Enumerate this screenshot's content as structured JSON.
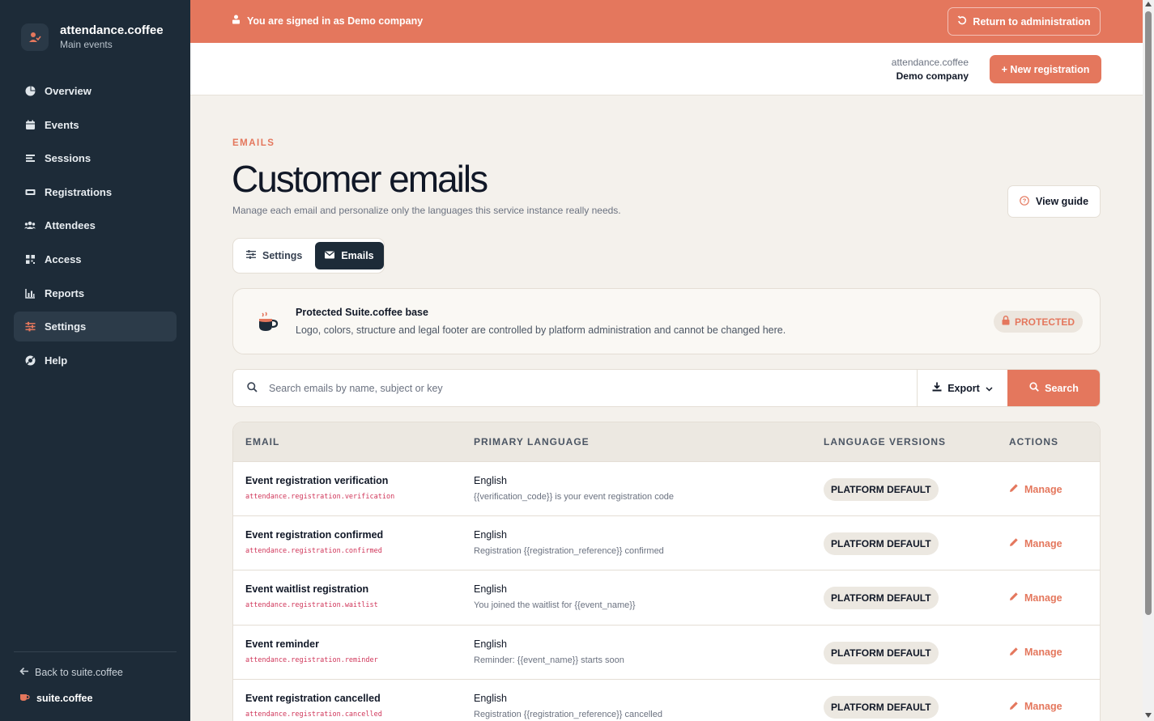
{
  "sidebar": {
    "brand_title": "attendance.coffee",
    "brand_subtitle": "Main events",
    "items": [
      {
        "label": "Overview",
        "icon": "pie-chart-icon"
      },
      {
        "label": "Events",
        "icon": "calendar-icon"
      },
      {
        "label": "Sessions",
        "icon": "list-icon"
      },
      {
        "label": "Registrations",
        "icon": "ticket-icon"
      },
      {
        "label": "Attendees",
        "icon": "users-icon"
      },
      {
        "label": "Access",
        "icon": "qr-code-icon"
      },
      {
        "label": "Reports",
        "icon": "bar-chart-icon"
      },
      {
        "label": "Settings",
        "icon": "sliders-icon",
        "active": true
      },
      {
        "label": "Help",
        "icon": "help-circle-icon"
      }
    ],
    "back_label": "Back to suite.coffee",
    "suite_label": "suite.coffee"
  },
  "banner": {
    "text": "You are signed in as Demo company",
    "return_label": "Return to administration"
  },
  "header": {
    "app_name": "attendance.coffee",
    "org_name": "Demo company",
    "new_registration_label": "+ New registration"
  },
  "main": {
    "eyebrow": "EMAILS",
    "title": "Customer emails",
    "description": "Manage each email and personalize only the languages this service instance really needs.",
    "guide_label": "View guide",
    "tabs": [
      {
        "label": "Settings"
      },
      {
        "label": "Emails",
        "active": true
      }
    ],
    "protected": {
      "title": "Protected Suite.coffee base",
      "description": "Logo, colors, structure and legal footer are controlled by platform administration and cannot be changed here.",
      "badge": "PROTECTED"
    },
    "search": {
      "placeholder": "Search emails by name, subject or key",
      "export_label": "Export",
      "search_label": "Search"
    },
    "table": {
      "columns": [
        "EMAIL",
        "PRIMARY LANGUAGE",
        "LANGUAGE VERSIONS",
        "ACTIONS"
      ],
      "rows": [
        {
          "name": "Event registration verification",
          "key": "attendance.registration.verification",
          "language": "English",
          "subject": "{{verification_code}} is your event registration code",
          "versions": "PLATFORM DEFAULT",
          "action": "Manage"
        },
        {
          "name": "Event registration confirmed",
          "key": "attendance.registration.confirmed",
          "language": "English",
          "subject": "Registration {{registration_reference}} confirmed",
          "versions": "PLATFORM DEFAULT",
          "action": "Manage"
        },
        {
          "name": "Event waitlist registration",
          "key": "attendance.registration.waitlist",
          "language": "English",
          "subject": "You joined the waitlist for {{event_name}}",
          "versions": "PLATFORM DEFAULT",
          "action": "Manage"
        },
        {
          "name": "Event reminder",
          "key": "attendance.registration.reminder",
          "language": "English",
          "subject": "Reminder: {{event_name}} starts soon",
          "versions": "PLATFORM DEFAULT",
          "action": "Manage"
        },
        {
          "name": "Event registration cancelled",
          "key": "attendance.registration.cancelled",
          "language": "English",
          "subject": "Registration {{registration_reference}} cancelled",
          "versions": "PLATFORM DEFAULT",
          "action": "Manage"
        }
      ]
    }
  },
  "colors": {
    "accent": "#e4775d",
    "sidebar": "#1d2b38",
    "background": "#f4f1ec",
    "key_text": "#d0365a"
  }
}
